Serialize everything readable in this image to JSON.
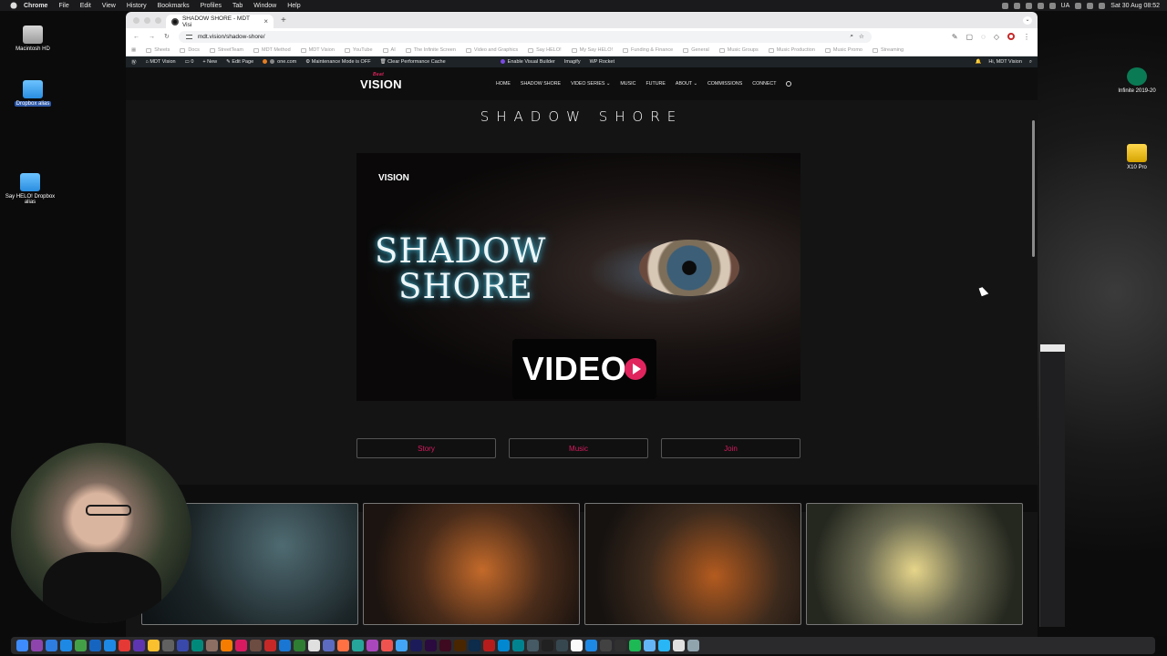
{
  "menubar": {
    "app": "Chrome",
    "items": [
      "File",
      "Edit",
      "View",
      "History",
      "Bookmarks",
      "Profiles",
      "Tab",
      "Window",
      "Help"
    ],
    "input_lang": "UA",
    "datetime": "Sat 30 Aug  08:52"
  },
  "desktop": {
    "icons": [
      {
        "label": "Macintosh HD"
      },
      {
        "label": "Dropbox alias"
      },
      {
        "label": "Say HELO! Dropbox alias"
      },
      {
        "label": "Infinite 2019-20"
      },
      {
        "label": "X10 Pro"
      }
    ]
  },
  "browser": {
    "tab_title": "SHADOW SHORE - MDT Visi",
    "tab_close": "×",
    "new_tab": "+",
    "url": "mdt.vision/shadow-shore/",
    "bookmarks": [
      "Sheets",
      "Docs",
      "StreetTeam",
      "MDT Method",
      "MDT Vision",
      "YouTube",
      "AI",
      "The Infinite Screen",
      "Video and Graphics",
      "Say HELO!",
      "My Say HELO!",
      "Funding & Finance",
      "General",
      "Music Groups",
      "Music Production",
      "Music Promo",
      "Streaming"
    ]
  },
  "wp_admin": {
    "site": "MDT Vision",
    "comments": "0",
    "new": "New",
    "edit_page": "Edit Page",
    "onecom": "one.com",
    "maintenance": "Maintenance Mode is OFF",
    "cache": "Clear Performance Cache",
    "visual_builder": "Enable Visual Builder",
    "imagify": "Imagify",
    "wp_rocket": "WP Rocket",
    "greeting": "Hi, MDT Vision"
  },
  "site": {
    "logo_small": "Beat",
    "logo": "VISION",
    "nav": [
      "HOME",
      "SHADOW SHORE",
      "VIDEO SERIES ⌄",
      "MUSIC",
      "FUTURE",
      "ABOUT ⌄",
      "COMMISSIONS",
      "CONNECT"
    ],
    "page_title": "SHADOW SHORE",
    "hero": {
      "logo": "VISION",
      "title_line1": "SHADOW",
      "title_line2": "SHORE",
      "badge": "VIDEO"
    },
    "buttons": [
      "Story",
      "Music",
      "Join"
    ]
  },
  "colors": {
    "accent": "#d81b60",
    "wp_bar": "#1d2327",
    "site_bg": "#141414"
  }
}
